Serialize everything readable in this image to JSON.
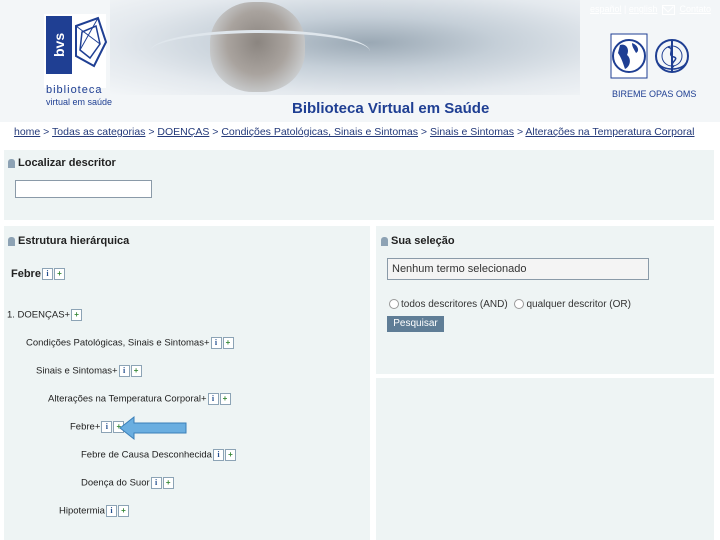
{
  "header": {
    "title": "Biblioteca Virtual em Saúde",
    "logo": {
      "mark": "bvs",
      "line1": "biblioteca",
      "line2": "virtual em saúde"
    },
    "links": {
      "lang1": "español",
      "sep1": "|",
      "lang2": "english",
      "contact": "Contato"
    },
    "orgs": "BIREME OPAS OMS"
  },
  "breadcrumb": [
    "home",
    " > ",
    "Todas as categorias",
    " > ",
    "DOENÇAS",
    " > ",
    "Condições Patológicas, Sinais e Sintomas",
    " > ",
    "Sinais e Sintomas",
    " > ",
    "Alterações na Temperatura Corporal"
  ],
  "locate": {
    "title": "Localizar descritor",
    "value": ""
  },
  "tree": {
    "title": "Estrutura hierárquica",
    "term": "Febre",
    "items": [
      "1.  DOENÇAS+",
      "Condições Patológicas, Sinais e Sintomas+",
      "Sinais e Sintomas+",
      "Alterações na Temperatura Corporal+",
      "Febre+",
      "Febre de Causa Desconhecida",
      "Doença do Suor",
      "Hipotermia"
    ]
  },
  "selection": {
    "title": "Sua seleção",
    "value": "Nenhum termo selecionado",
    "opt1": "todos descritores (AND)",
    "opt2": "qualquer descritor (OR)",
    "button": "Pesquisar"
  },
  "colors": {
    "brand": "#1f3f93",
    "panel": "#eef4f4",
    "button": "#5f7d96",
    "arrow": "#6aaee0"
  },
  "icons": {
    "info": "i",
    "plus": "+"
  }
}
